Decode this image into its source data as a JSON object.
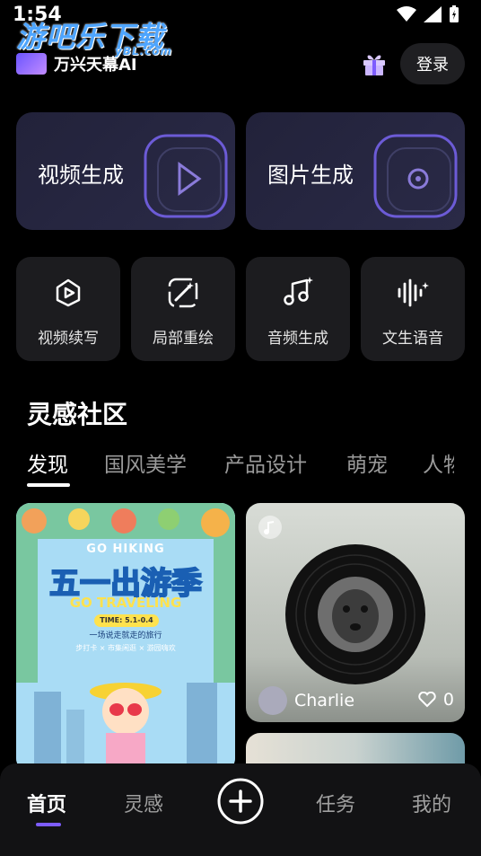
{
  "status_bar": {
    "time": "1:54"
  },
  "watermark": {
    "title": "游吧乐下载",
    "sub": "yBL.com"
  },
  "header": {
    "brand_name": "万兴天幕AI",
    "login_label": "登录"
  },
  "feature_cards": [
    {
      "label": "视频生成",
      "icon": "play-frame-icon"
    },
    {
      "label": "图片生成",
      "icon": "image-frame-icon"
    }
  ],
  "tools": [
    {
      "label": "视频续写",
      "icon": "video-extend-icon"
    },
    {
      "label": "局部重绘",
      "icon": "magic-wand-icon"
    },
    {
      "label": "音频生成",
      "icon": "music-note-icon"
    },
    {
      "label": "文生语音",
      "icon": "voice-wave-icon"
    }
  ],
  "community": {
    "title": "灵感社区",
    "tabs": [
      "发现",
      "国风美学",
      "产品设计",
      "萌宠",
      "人物"
    ],
    "active_tab": 0
  },
  "feed": {
    "left_card": {
      "line1": "GO HIKING",
      "line2": "五一出游季",
      "line3": "GO TRAVELING",
      "time": "TIME: 5.1-0.4",
      "sub": "一场说走就走的旅行",
      "tags": "步打卡 × 市集闲逛 × 游园嗨欢"
    },
    "right_card": {
      "author": "Charlie",
      "likes": "0"
    }
  },
  "bottom_nav": {
    "items": [
      "首页",
      "灵感",
      "任务",
      "我的"
    ],
    "active": 0
  }
}
